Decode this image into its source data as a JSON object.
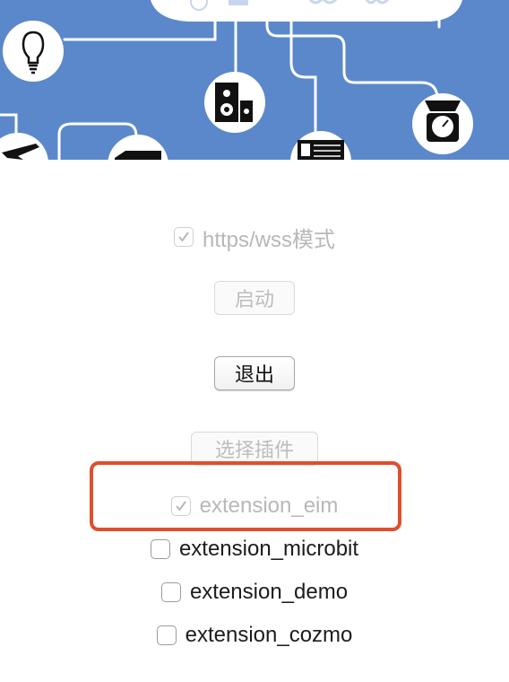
{
  "banner": {
    "background_color": "#5b88ca",
    "icons": [
      "lightbulb-icon",
      "speaker-icon",
      "scale-icon",
      "airplane-icon",
      "car-icon",
      "device-icon",
      "cloud-icon"
    ]
  },
  "https_toggle": {
    "label": "https/wss模式",
    "checked": true,
    "disabled": true
  },
  "buttons": {
    "start": {
      "label": "启动",
      "disabled": true
    },
    "quit": {
      "label": "退出",
      "disabled": false
    },
    "select_plugin": {
      "label": "选择插件",
      "disabled": true
    }
  },
  "extensions": [
    {
      "label": "extension_eim",
      "checked": true,
      "disabled": true
    },
    {
      "label": "extension_microbit",
      "checked": false,
      "disabled": false
    },
    {
      "label": "extension_demo",
      "checked": false,
      "disabled": false
    },
    {
      "label": "extension_cozmo",
      "checked": false,
      "disabled": false
    }
  ],
  "highlight_color": "#e04e2c"
}
